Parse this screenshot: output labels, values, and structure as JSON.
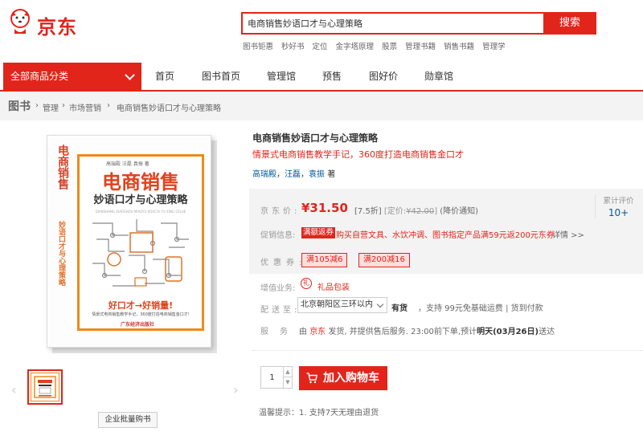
{
  "header": {
    "logo_text": "京东",
    "search_value": "电商销售妙语口才与心理策略",
    "search_button": "搜索",
    "hotwords": [
      "图书钜惠",
      "秒好书",
      "定位",
      "金字塔原理",
      "股票",
      "管理书籍",
      "销售书籍",
      "管理学"
    ]
  },
  "nav": {
    "category_button": "全部商品分类",
    "items": [
      "首页",
      "图书首页",
      "管理馆",
      "预售",
      "图好价",
      "勋章馆"
    ]
  },
  "breadcrumb": {
    "root": "图书",
    "items": [
      "管理",
      "市场营销",
      "电商销售妙语口才与心理策略"
    ]
  },
  "cover": {
    "spine_title": "电商销售",
    "spine_subtitle": "妙语口才与心理策略",
    "authors": "高瑞殿 汪磊 袁振 著",
    "title": "电商销售",
    "subtitle": "妙语口才与心理策略",
    "pinyin": "DIANSHANG XIAOSHOU MIAOYU KOUCAI YU XINLI CELUE",
    "slogan": "好口才→好销量!",
    "desc": "情景式电商销售教学手记，360度打造电商销售金口才!",
    "publisher": "广东经济出版社"
  },
  "gallery": {
    "prev": "‹",
    "next": "›",
    "bulk_button": "企业批量购书"
  },
  "product": {
    "name": "电商销售妙语口才与心理策略",
    "slogan": "情景式电商销售教学手记，360度打造电商销售金口才",
    "authors": [
      "高瑞殿",
      "汪磊",
      "袁振"
    ],
    "author_suffix": "著",
    "price_label": "京东价:",
    "price": "¥31.50",
    "discount": "[7.5折]",
    "list_price_label": "[定价:",
    "list_price": "¥42.00",
    "list_price_end": "]",
    "price_notify": "(降价通知)",
    "review_label": "累计评价",
    "review_count": "10+",
    "promo_label": "促销信息:",
    "promo_tag": "满额返券",
    "promo_text": "购买自营文具、水饮冲调、图书指定产品满59元返200元东券",
    "promo_detail": "详情 >>",
    "coupon_label": "优惠券:",
    "coupons": [
      "满105减6",
      "满200减16"
    ],
    "addon_label": "增值业务:",
    "addon_text": "礼品包装",
    "ship_label": "配送至:",
    "ship_address": "北京朝阳区三环以内",
    "stock": "有货",
    "ship_info": "，支持 99元免基础运费 | 货到付款",
    "service_label": "服务:",
    "service_prefix": "由",
    "service_seller": "京东",
    "service_mid": "发货, 并提供售后服务. 23:00前下单,预计",
    "service_date": "明天(03月26日)",
    "service_suffix": "送达",
    "quantity": "1",
    "add_to_cart": "加入购物车",
    "tips": "温馨提示：1. 支持7天无理由退货"
  },
  "colors": {
    "brand_red": "#e1251b",
    "link_blue": "#005aa0",
    "cover_orange": "#f08a1c"
  }
}
